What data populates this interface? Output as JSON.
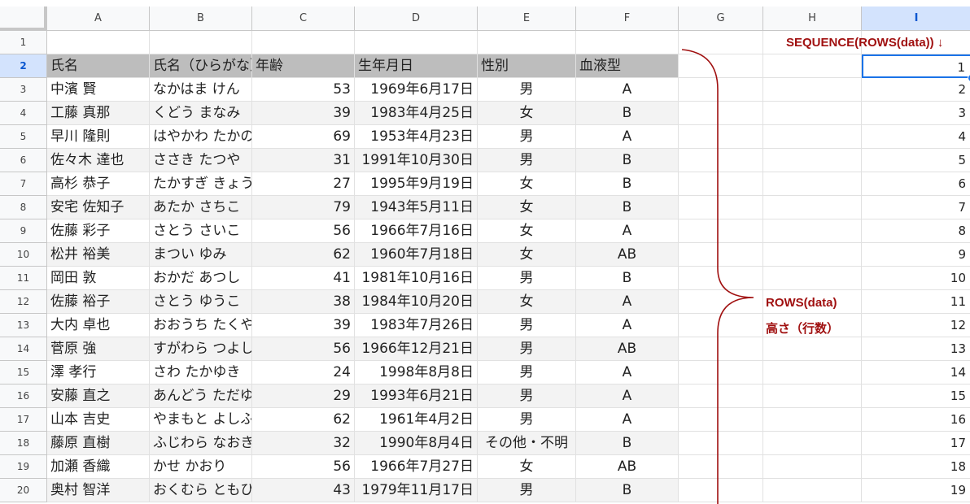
{
  "sheet": {
    "columns": [
      "A",
      "B",
      "C",
      "D",
      "E",
      "F",
      "G",
      "H",
      "I"
    ],
    "selected_column": "I",
    "selected_row": "2",
    "rows": [
      {
        "n": "1",
        "cells": [
          "",
          "",
          "",
          "",
          "",
          "",
          "",
          "",
          ""
        ]
      },
      {
        "n": "2",
        "cells": [
          "氏名",
          "氏名（ひらがな）",
          "年齢",
          "生年月日",
          "性別",
          "血液型",
          "",
          "",
          "1"
        ]
      },
      {
        "n": "3",
        "cells": [
          "中濱 賢",
          "なかはま けん",
          "53",
          "1969年6月17日",
          "男",
          "A",
          "",
          "",
          "2"
        ]
      },
      {
        "n": "4",
        "cells": [
          "工藤 真那",
          "くどう まなみ",
          "39",
          "1983年4月25日",
          "女",
          "B",
          "",
          "",
          "3"
        ]
      },
      {
        "n": "5",
        "cells": [
          "早川 隆則",
          "はやかわ たかのり",
          "69",
          "1953年4月23日",
          "男",
          "A",
          "",
          "",
          "4"
        ]
      },
      {
        "n": "6",
        "cells": [
          "佐々木 達也",
          "ささき たつや",
          "31",
          "1991年10月30日",
          "男",
          "B",
          "",
          "",
          "5"
        ]
      },
      {
        "n": "7",
        "cells": [
          "高杉 恭子",
          "たかすぎ きょうこ",
          "27",
          "1995年9月19日",
          "女",
          "B",
          "",
          "",
          "6"
        ]
      },
      {
        "n": "8",
        "cells": [
          "安宅 佐知子",
          "あたか さちこ",
          "79",
          "1943年5月11日",
          "女",
          "B",
          "",
          "",
          "7"
        ]
      },
      {
        "n": "9",
        "cells": [
          "佐藤 彩子",
          "さとう さいこ",
          "56",
          "1966年7月16日",
          "女",
          "A",
          "",
          "",
          "8"
        ]
      },
      {
        "n": "10",
        "cells": [
          "松井 裕美",
          "まつい ゆみ",
          "62",
          "1960年7月18日",
          "女",
          "AB",
          "",
          "",
          "9"
        ]
      },
      {
        "n": "11",
        "cells": [
          "岡田 敦",
          "おかだ あつし",
          "41",
          "1981年10月16日",
          "男",
          "B",
          "",
          "",
          "10"
        ]
      },
      {
        "n": "12",
        "cells": [
          "佐藤 裕子",
          "さとう ゆうこ",
          "38",
          "1984年10月20日",
          "女",
          "A",
          "",
          "",
          "11"
        ]
      },
      {
        "n": "13",
        "cells": [
          "大内 卓也",
          "おおうち たくや",
          "39",
          "1983年7月26日",
          "男",
          "A",
          "",
          "",
          "12"
        ]
      },
      {
        "n": "14",
        "cells": [
          "菅原 強",
          "すがわら つよし",
          "56",
          "1966年12月21日",
          "男",
          "AB",
          "",
          "",
          "13"
        ]
      },
      {
        "n": "15",
        "cells": [
          "澤 孝行",
          "さわ たかゆき",
          "24",
          "1998年8月8日",
          "男",
          "A",
          "",
          "",
          "14"
        ]
      },
      {
        "n": "16",
        "cells": [
          "安藤 直之",
          "あんどう ただゆき",
          "29",
          "1993年6月21日",
          "男",
          "A",
          "",
          "",
          "15"
        ]
      },
      {
        "n": "17",
        "cells": [
          "山本 吉史",
          "やまもと よしふみ",
          "62",
          "1961年4月2日",
          "男",
          "A",
          "",
          "",
          "16"
        ]
      },
      {
        "n": "18",
        "cells": [
          "藤原 直樹",
          "ふじわら なおき",
          "32",
          "1990年8月4日",
          "その他・不明",
          "B",
          "",
          "",
          "17"
        ]
      },
      {
        "n": "19",
        "cells": [
          "加瀬 香織",
          "かせ かおり",
          "56",
          "1966年7月27日",
          "女",
          "AB",
          "",
          "",
          "18"
        ]
      },
      {
        "n": "20",
        "cells": [
          "奥村 智洋",
          "おくむら ともひろ",
          "43",
          "1979年11月17日",
          "男",
          "B",
          "",
          "",
          "19"
        ]
      }
    ]
  },
  "annotations": {
    "sequence_label": "SEQUENCE(ROWS(data)) ↓",
    "rows_label": "ROWS(data)",
    "height_label": "高さ（行数）"
  },
  "colors": {
    "annotation": "#a01010",
    "selection": "#1a73e8",
    "header_fill": "#bdbdbd",
    "band_fill": "#f3f3f3"
  }
}
